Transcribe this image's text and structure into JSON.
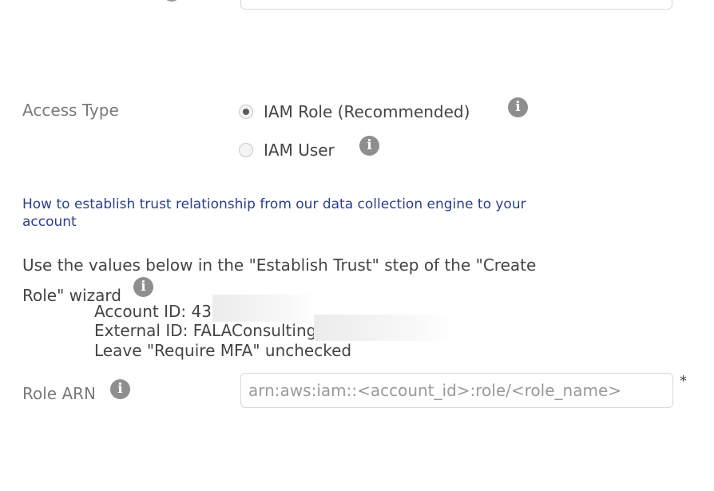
{
  "access_type": {
    "label": "Access Type",
    "options": [
      {
        "label": "IAM Role (Recommended)",
        "checked": true
      },
      {
        "label": "IAM User",
        "checked": false
      }
    ]
  },
  "help": {
    "link_text": "How to establish trust relationship from our data collection engine to your account"
  },
  "instructions": {
    "text": "Use the values below in the \"Establish Trust\" step of the \"Create Role\" wizard",
    "account_id": "Account ID: 43",
    "external_id": "External ID: FALAConsulting",
    "mfa_note": "Leave \"Require MFA\" unchecked"
  },
  "role_arn": {
    "label": "Role ARN",
    "value": "",
    "placeholder": "arn:aws:iam::<account_id>:role/<role_name>",
    "required_marker": "*"
  },
  "colors": {
    "label": "#7a7a7a",
    "text": "#444444",
    "link": "#2b3f8c",
    "info_icon": "#8e8e8e",
    "border": "#d9d9d9"
  },
  "icons": {
    "info": "info-icon",
    "info_glyph": "i"
  }
}
